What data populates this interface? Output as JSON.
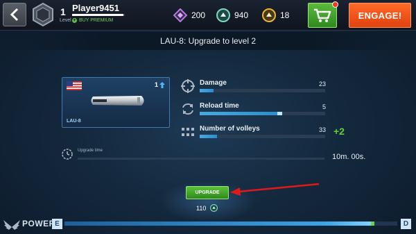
{
  "topbar": {
    "level": "1",
    "level_label": "Level",
    "player_name": "Player9451",
    "xp_progress": 0.97,
    "buy_premium": "BUY PREMIUM",
    "currencies": [
      {
        "icon": "silver-crystal-icon",
        "value": "200",
        "color": "#b67be0"
      },
      {
        "icon": "credits-coin-icon",
        "value": "940",
        "color": "#7fd7c4"
      },
      {
        "icon": "gold-coin-icon",
        "value": "18",
        "color": "#f0b43a"
      }
    ],
    "engage_label": "ENGAGE!"
  },
  "title": "LAU-8: Upgrade to level 2",
  "weapon": {
    "name": "LAU-8",
    "level": "1",
    "flag": "us-flag-icon"
  },
  "stats": [
    {
      "label": "Damage",
      "value": "23",
      "icon": "crosshair-icon",
      "fill": 0.11,
      "bonus": 0
    },
    {
      "label": "Reload time",
      "value": "5",
      "icon": "reload-icon",
      "fill": 0.66,
      "bonus": 0.04
    },
    {
      "label": "Number of volleys",
      "value": "33",
      "icon": "volleys-grid-icon",
      "fill": 0.14,
      "bonus": 0,
      "increase": "+2"
    }
  ],
  "upgrade_time": {
    "label": "Upgrade time",
    "value": "10m. 00s."
  },
  "upgrade": {
    "button_label": "UPGRADE",
    "cost": "110",
    "cost_icon": "credits-coin-icon"
  },
  "power": {
    "label": "POWER",
    "grade_from": "E",
    "grade_to": "D",
    "fill": 0.92,
    "gain": 0.012
  },
  "colors": {
    "accent_blue": "#3aa3e8",
    "engage_orange": "#f05a1e",
    "shop_green": "#4aa82e",
    "upgrade_green": "#4cb02c",
    "increase_green": "#62d034",
    "arrow_red": "#e0191b"
  }
}
